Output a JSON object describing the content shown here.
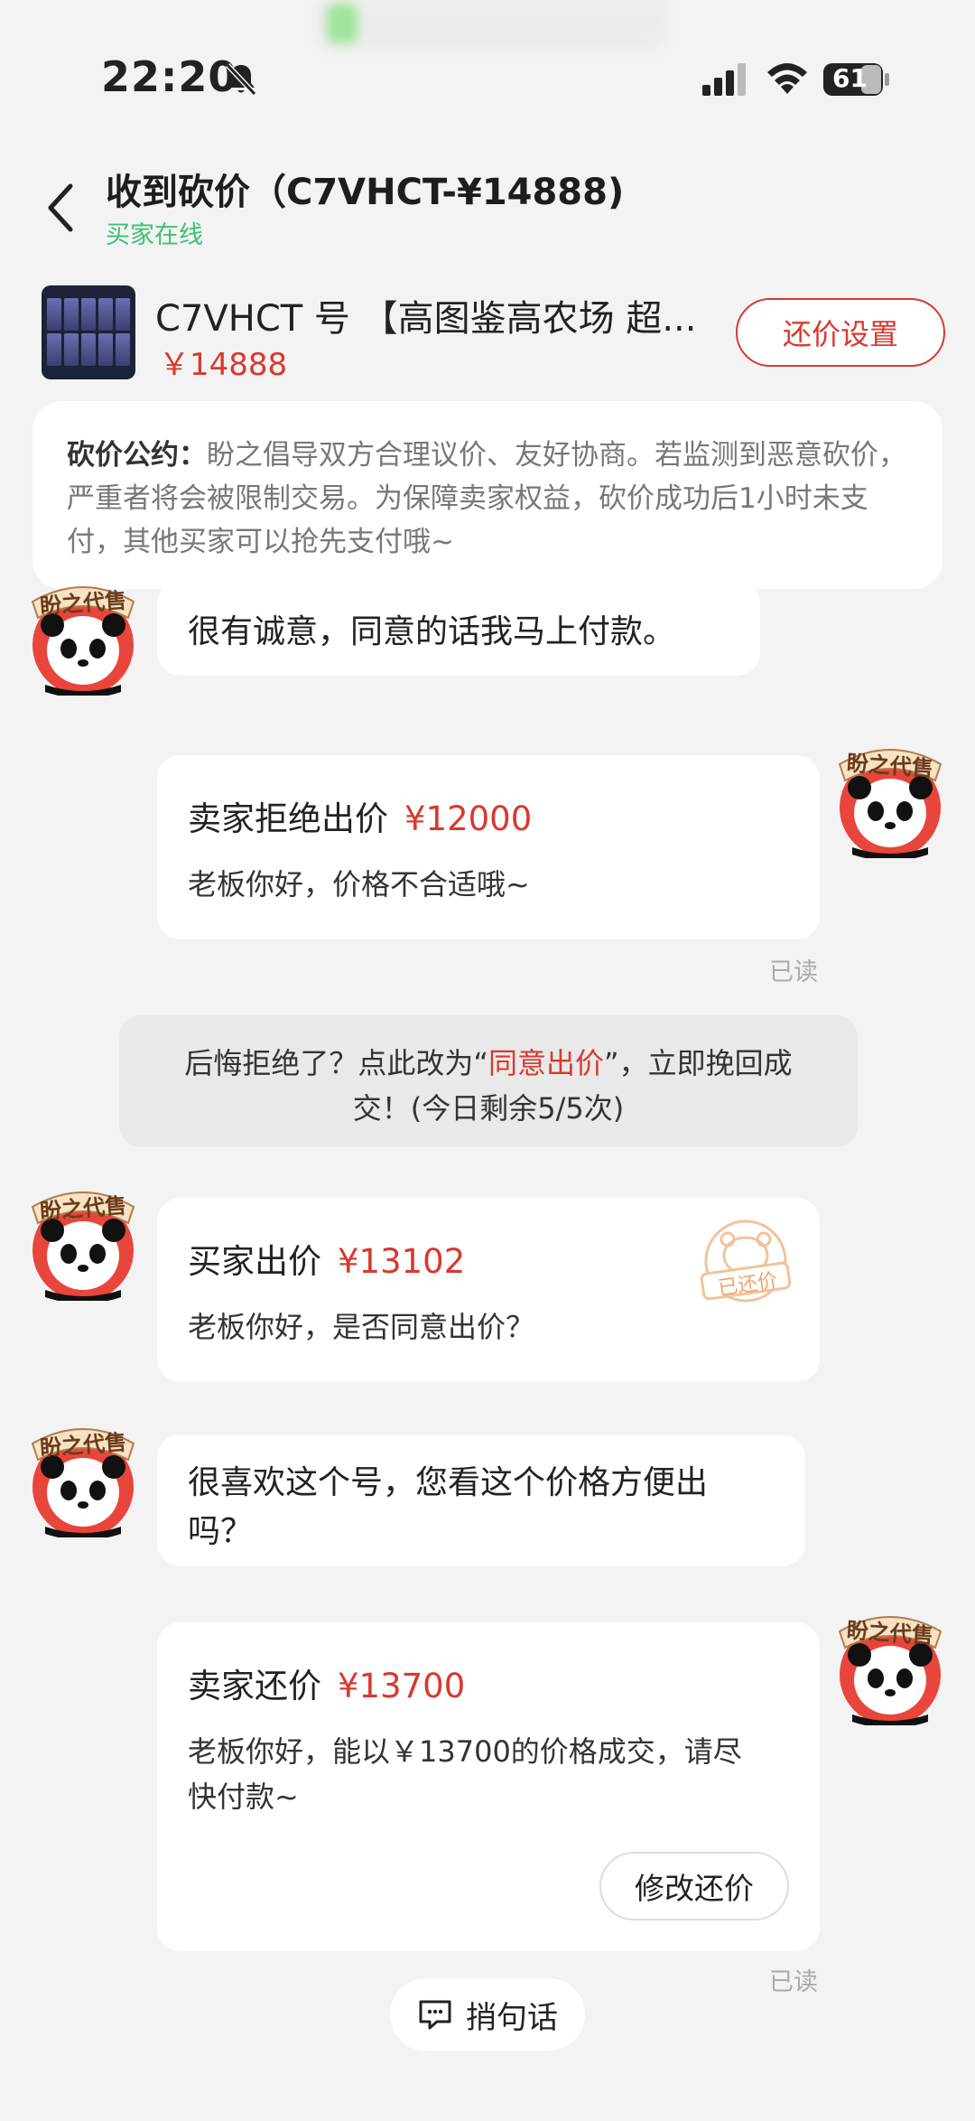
{
  "status_bar": {
    "time": "22:20",
    "battery": "61"
  },
  "header": {
    "title": "收到砍价（C7VHCT-¥14888)",
    "subtitle": "买家在线"
  },
  "product": {
    "title": "C7VHCT 号 【高图鉴高农场 超...",
    "price": "￥14888",
    "counter_button": "还价设置"
  },
  "notice": {
    "label": "砍价公约：",
    "text": "盼之倡导双方合理议价、友好协商。若监测到恶意砍价，严重者将会被限制交易。为保障卖家权益，砍价成功后1小时未支付，其他买家可以抢先支付哦~"
  },
  "avatar_label": "盼之代售",
  "messages": {
    "m1": {
      "text": "很有诚意，同意的话我马上付款。"
    },
    "m2": {
      "title": "卖家拒绝出价",
      "amount": "¥12000",
      "body": "老板你好，价格不合适哦~",
      "status": "已读"
    },
    "sys": {
      "prefix": "后悔拒绝了？点此改为“",
      "link": "同意出价",
      "suffix": "”，立即挽回成",
      "line2": "交！(今日剩余5/5次)"
    },
    "m3": {
      "title": "买家出价",
      "amount": "¥13102",
      "body": "老板你好，是否同意出价？",
      "stamp": "已还价"
    },
    "m4": {
      "line1": "很喜欢这个号，您看这个价格方便出",
      "line2": "吗？"
    },
    "m5": {
      "title": "卖家还价",
      "amount": "¥13700",
      "body_line1": "老板你好，能以￥13700的价格成交，请尽",
      "body_line2": "快付款~",
      "button": "修改还价",
      "status": "已读"
    }
  },
  "quick_reply": {
    "label": "捎句话"
  },
  "colors": {
    "accent_red": "#d8392f",
    "online_green": "#3fbf74",
    "background": "#f3f3f3"
  }
}
